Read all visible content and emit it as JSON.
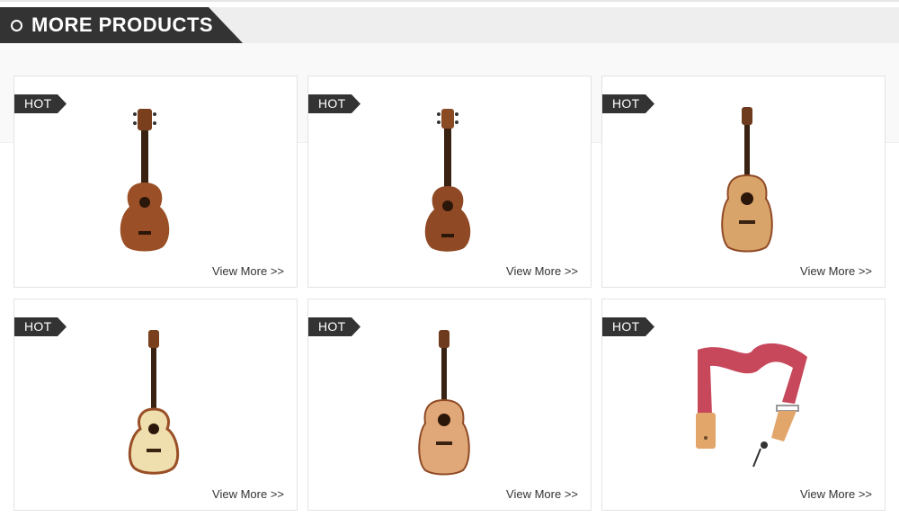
{
  "section": {
    "title": "MORE PRODUCTS",
    "icon": "ring-icon"
  },
  "products": [
    {
      "badge": "HOT",
      "link": "View More >>",
      "image": "mahogany-concert-ukulele"
    },
    {
      "badge": "HOT",
      "link": "View More >>",
      "image": "mahogany-tenor-ukulele"
    },
    {
      "badge": "HOT",
      "link": "View More >>",
      "image": "spruce-dreadnought-guitar"
    },
    {
      "badge": "HOT",
      "link": "View More >>",
      "image": "cutaway-travel-guitar"
    },
    {
      "badge": "HOT",
      "link": "View More >>",
      "image": "cedar-dreadnought-guitar"
    },
    {
      "badge": "HOT",
      "link": "View More >>",
      "image": "red-guitar-strap"
    }
  ],
  "colors": {
    "dark": "#333333",
    "band": "#eeeeee",
    "border": "#e3e3e3"
  }
}
